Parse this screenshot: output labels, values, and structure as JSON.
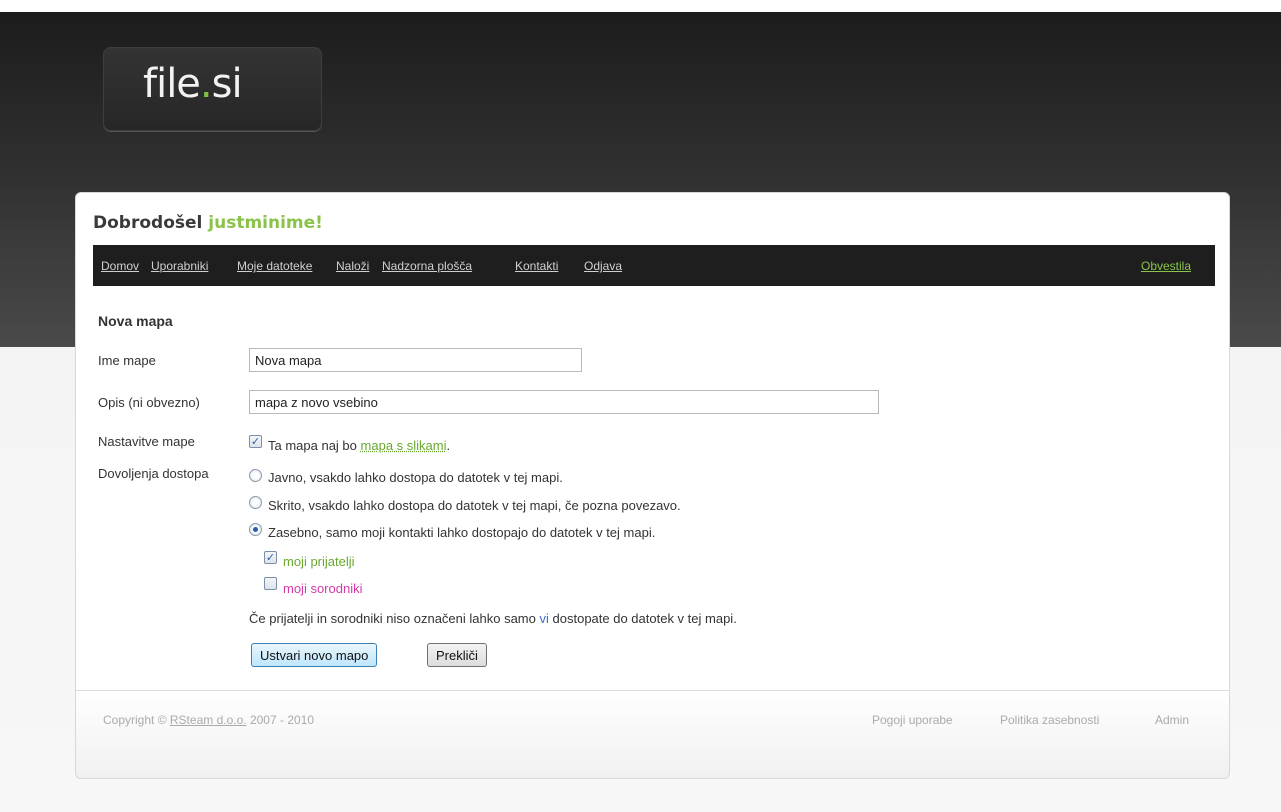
{
  "logo": {
    "text_a": "file",
    "dot": ".",
    "text_b": "si"
  },
  "welcome": {
    "prefix": "Dobrodošel",
    "username": "justminime!"
  },
  "nav": {
    "items": [
      "Domov",
      "Uporabniki",
      "Moje datoteke",
      "Naloži",
      "Nadzorna plošča",
      "Kontakti",
      "Odjava"
    ],
    "notifications": "Obvestila"
  },
  "form": {
    "title": "Nova mapa",
    "name_label": "Ime mape",
    "name_value": "Nova mapa",
    "desc_label": "Opis (ni obvezno)",
    "desc_value": "mapa z novo vsebino",
    "settings_label": "Nastavitve mape",
    "gallery_checked": true,
    "gallery_text": "Ta mapa naj bo",
    "gallery_link": "mapa s slikami",
    "gallery_suffix": ".",
    "access_label": "Dovoljenja dostopa",
    "access_options": [
      {
        "text": "Javno, vsakdo lahko dostopa do datotek v tej mapi.",
        "selected": false
      },
      {
        "text": "Skrito, vsakdo lahko dostopa do datotek v tej mapi, če pozna povezavo.",
        "selected": false
      },
      {
        "text": "Zasebno, samo moji kontakti lahko dostopajo do datotek v tej mapi.",
        "selected": true
      }
    ],
    "friends_label": "moji prijatelji",
    "friends_checked": true,
    "relatives_label": "moji sorodniki",
    "relatives_checked": false,
    "note_prefix": "Če prijatelji in sorodniki niso označeni lahko samo",
    "note_you": "vi",
    "note_suffix": "dostopate do datotek v tej mapi.",
    "submit_label": "Ustvari novo mapo",
    "cancel_label": "Prekliči"
  },
  "footer": {
    "copyright_prefix": "Copyright ©",
    "company": "RSteam d.o.o.",
    "years": "2007 - 2010",
    "links": [
      "Pogoji uporabe",
      "Politika zasebnosti",
      "Admin"
    ]
  },
  "colors": {
    "accent_green": "#8bc34a",
    "pink": "#d63aa8",
    "link_blue": "#3a6ec8",
    "nav_bg": "#1e1e1e"
  }
}
